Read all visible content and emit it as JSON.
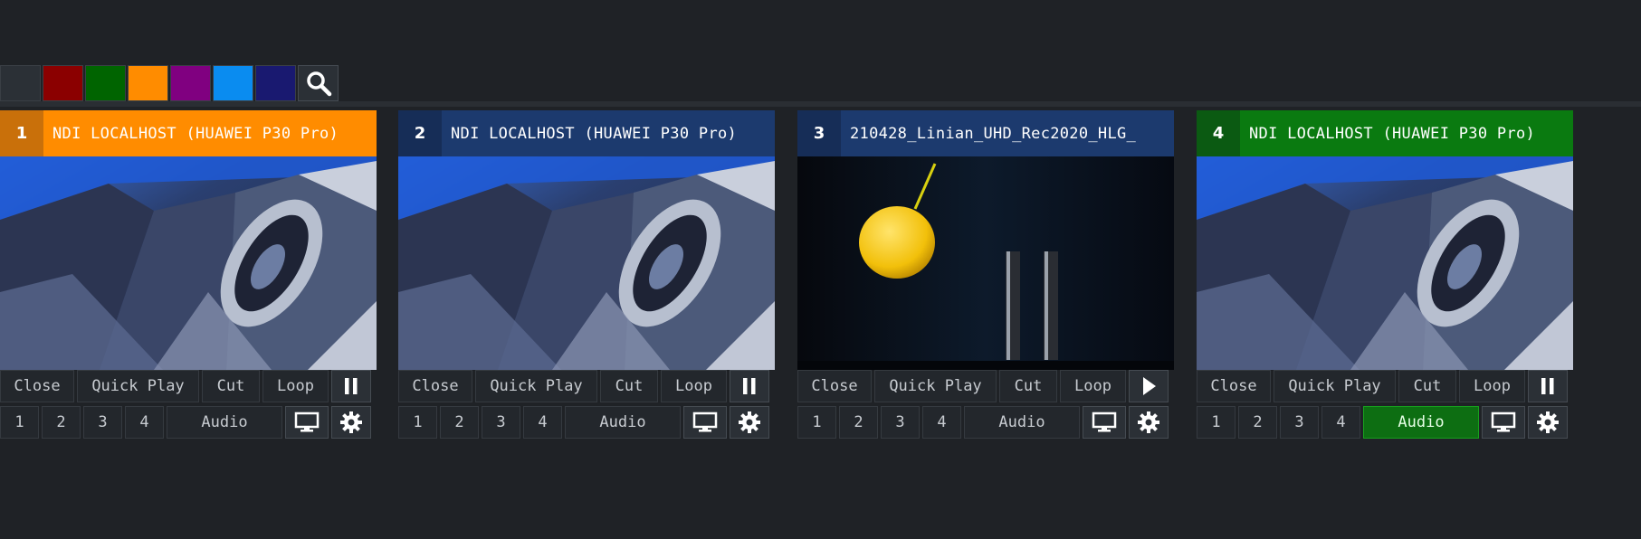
{
  "toolbar": {
    "swatches": [
      {
        "name": "swatch-dark",
        "color": "#2b3036"
      },
      {
        "name": "swatch-red",
        "color": "#8b0000"
      },
      {
        "name": "swatch-green",
        "color": "#006400"
      },
      {
        "name": "swatch-orange",
        "color": "#ff8c00"
      },
      {
        "name": "swatch-purple",
        "color": "#800080"
      },
      {
        "name": "swatch-blue",
        "color": "#0a8cf0"
      },
      {
        "name": "swatch-navy",
        "color": "#191970"
      }
    ],
    "search_icon": "search-icon"
  },
  "cards": [
    {
      "number": "1",
      "title": "NDI LOCALHOST (HUAWEI P30 Pro)",
      "header_color": "#ff8c00",
      "num_color": "#c9700a",
      "video": "camera",
      "controls": {
        "close": "Close",
        "quick_play": "Quick Play",
        "cut": "Cut",
        "loop": "Loop",
        "state": "pause"
      },
      "outputs": [
        "1",
        "2",
        "3",
        "4"
      ],
      "audio": "Audio",
      "audio_active": false
    },
    {
      "number": "2",
      "title": "NDI LOCALHOST (HUAWEI P30 Pro)",
      "header_color": "#1c3a6e",
      "num_color": "#162d57",
      "video": "camera",
      "controls": {
        "close": "Close",
        "quick_play": "Quick Play",
        "cut": "Cut",
        "loop": "Loop",
        "state": "pause"
      },
      "outputs": [
        "1",
        "2",
        "3",
        "4"
      ],
      "audio": "Audio",
      "audio_active": false
    },
    {
      "number": "3",
      "title": "210428_Linian_UHD_Rec2020_HLG_",
      "header_color": "#1c3a6e",
      "num_color": "#162d57",
      "video": "balloon",
      "controls": {
        "close": "Close",
        "quick_play": "Quick Play",
        "cut": "Cut",
        "loop": "Loop",
        "state": "play"
      },
      "outputs": [
        "1",
        "2",
        "3",
        "4"
      ],
      "audio": "Audio",
      "audio_active": false
    },
    {
      "number": "4",
      "title": "NDI LOCALHOST (HUAWEI P30 Pro)",
      "header_color": "#0a7a10",
      "num_color": "#0b5a12",
      "video": "camera",
      "controls": {
        "close": "Close",
        "quick_play": "Quick Play",
        "cut": "Cut",
        "loop": "Loop",
        "state": "pause"
      },
      "outputs": [
        "1",
        "2",
        "3",
        "4"
      ],
      "audio": "Audio",
      "audio_active": true
    }
  ]
}
